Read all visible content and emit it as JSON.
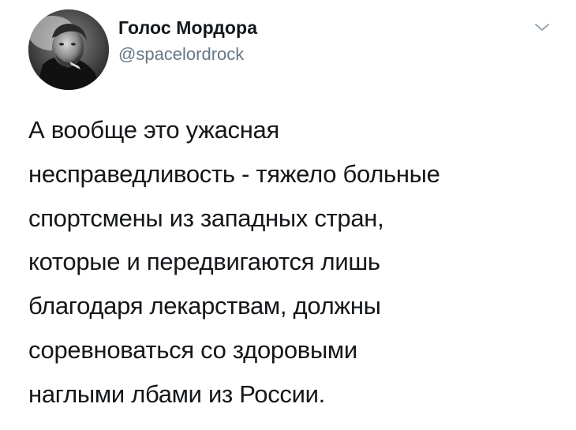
{
  "author": {
    "display_name": "Голос Мордора",
    "handle": "@spacelordrock"
  },
  "icons": {
    "avatar": "profile-photo",
    "menu": "chevron-down-icon"
  },
  "tweet": {
    "lines": [
      "А вообще это ужасная",
      "несправедливость - тяжело больные",
      "спортсмены из западных стран,",
      "которые и передвигаются лишь",
      "благодаря лекарствам, должны",
      "соревноваться со здоровыми",
      "наглыми лбами из России."
    ]
  },
  "colors": {
    "text": "#14171a",
    "secondary": "#657786",
    "background": "#ffffff"
  }
}
